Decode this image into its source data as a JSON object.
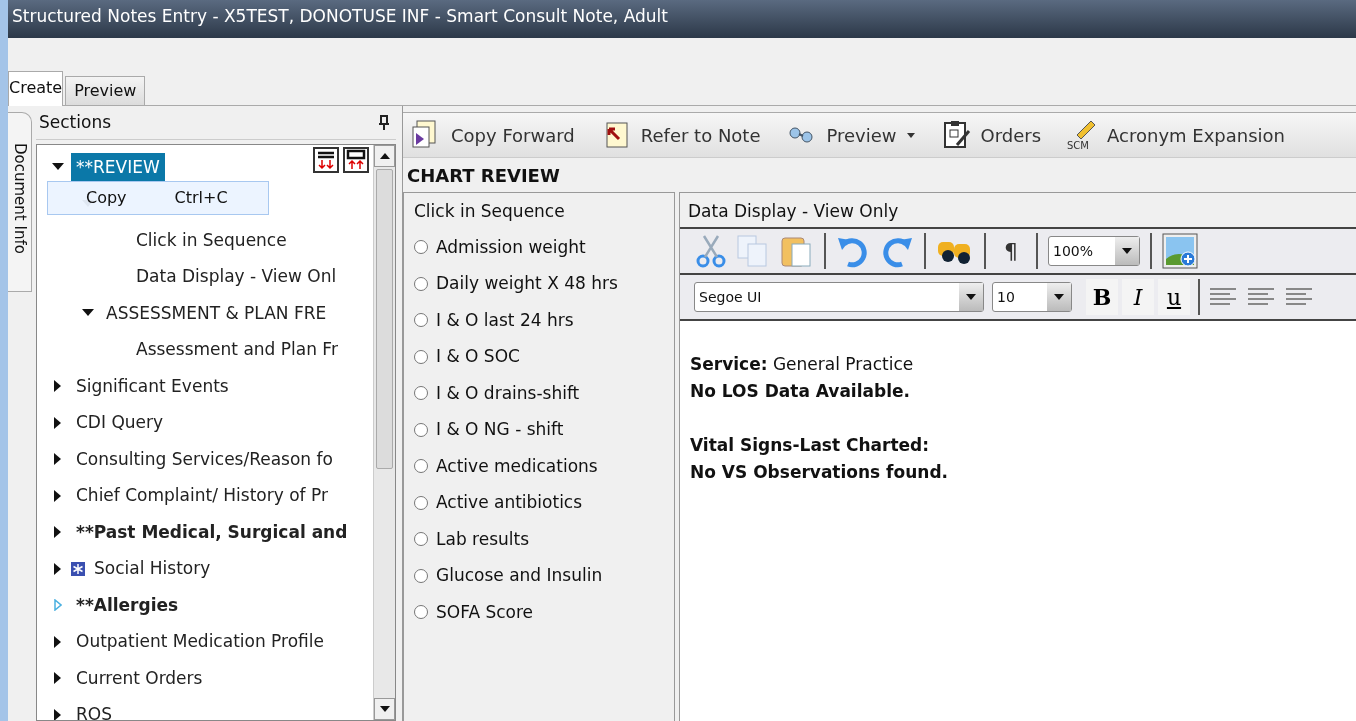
{
  "window": {
    "title": "Structured Notes Entry - X5TEST, DONOTUSE INF - Smart Consult Note, Adult"
  },
  "tabs": [
    {
      "label": "Create",
      "selected": true
    },
    {
      "label": "Preview",
      "selected": false
    }
  ],
  "side_tab": {
    "label": "Document Info"
  },
  "sections": {
    "title": "Sections",
    "tree": [
      {
        "label": "**REVIEW",
        "expanded": true,
        "selected": true,
        "children": [
          {
            "expanded": true,
            "children": [
              {
                "label": "Click in Sequence",
                "selected": false
              },
              {
                "label": "Data Display - View Onl",
                "selected": false
              }
            ]
          },
          {
            "label": "ASSESSMENT & PLAN FRE",
            "expanded": true,
            "selected": false,
            "children": [
              {
                "label": "Assessment and Plan Fr",
                "selected": false
              }
            ]
          }
        ]
      },
      {
        "label": "Significant Events",
        "expanded": false,
        "selected": false
      },
      {
        "label": "CDI Query",
        "expanded": false,
        "selected": false
      },
      {
        "label": "Consulting Services/Reason fo",
        "expanded": false,
        "selected": false
      },
      {
        "label": "Chief Complaint/ History of Pr",
        "expanded": false,
        "selected": false
      },
      {
        "label": "**Past Medical, Surgical and",
        "expanded": false,
        "selected": false,
        "bold": true
      },
      {
        "label": "Social History",
        "expanded": false,
        "selected": false,
        "has_icon": true
      },
      {
        "label": "**Allergies",
        "expanded": false,
        "selected": false,
        "bold": true,
        "empty": true
      },
      {
        "label": "Outpatient Medication Profile",
        "expanded": false,
        "selected": false
      },
      {
        "label": "Current Orders",
        "expanded": false,
        "selected": false
      },
      {
        "label": "ROS",
        "expanded": false,
        "selected": false
      }
    ],
    "context_menu": {
      "label": "Copy",
      "shortcut": "Ctrl+C"
    }
  },
  "toolbar": [
    {
      "kind": "copy-forward",
      "label": "Copy Forward"
    },
    {
      "kind": "refer",
      "label": "Refer to Note"
    },
    {
      "kind": "preview",
      "label": "Preview",
      "dropdown": true
    },
    {
      "kind": "orders",
      "label": "Orders"
    },
    {
      "kind": "acronym",
      "label": "Acronym Expansion",
      "icon_text": "SCM"
    }
  ],
  "section_title": "CHART REVIEW",
  "sequence": {
    "title": "Click in Sequence",
    "items": [
      {
        "label": "Admission weight",
        "checked": false
      },
      {
        "label": "Daily weight X 48 hrs",
        "checked": false
      },
      {
        "label": "I & O last 24 hrs",
        "checked": false
      },
      {
        "label": "I & O SOC",
        "checked": false
      },
      {
        "label": "I & O drains-shift",
        "checked": false
      },
      {
        "label": "I & O NG - shift",
        "checked": false
      },
      {
        "label": "Active medications",
        "checked": false
      },
      {
        "label": "Active antibiotics",
        "checked": false
      },
      {
        "label": "Lab results",
        "checked": false
      },
      {
        "label": "Glucose and Insulin",
        "checked": false
      },
      {
        "label": "SOFA Score",
        "checked": false
      }
    ]
  },
  "display": {
    "title": "Data Display - View Only",
    "pilcrow": "¶",
    "zoom": "100%",
    "font": "Segoe UI",
    "size": "10",
    "format_buttons": [
      {
        "kind": "bold",
        "label": "B"
      },
      {
        "kind": "italic",
        "label": "I"
      },
      {
        "kind": "underline",
        "label": "u"
      }
    ],
    "content": [
      [
        "**Service:** General Practice",
        "**No LOS Data Available.**"
      ],
      [
        "**Vital Signs-Last Charted:**",
        "**No VS Observations found.**"
      ]
    ]
  }
}
